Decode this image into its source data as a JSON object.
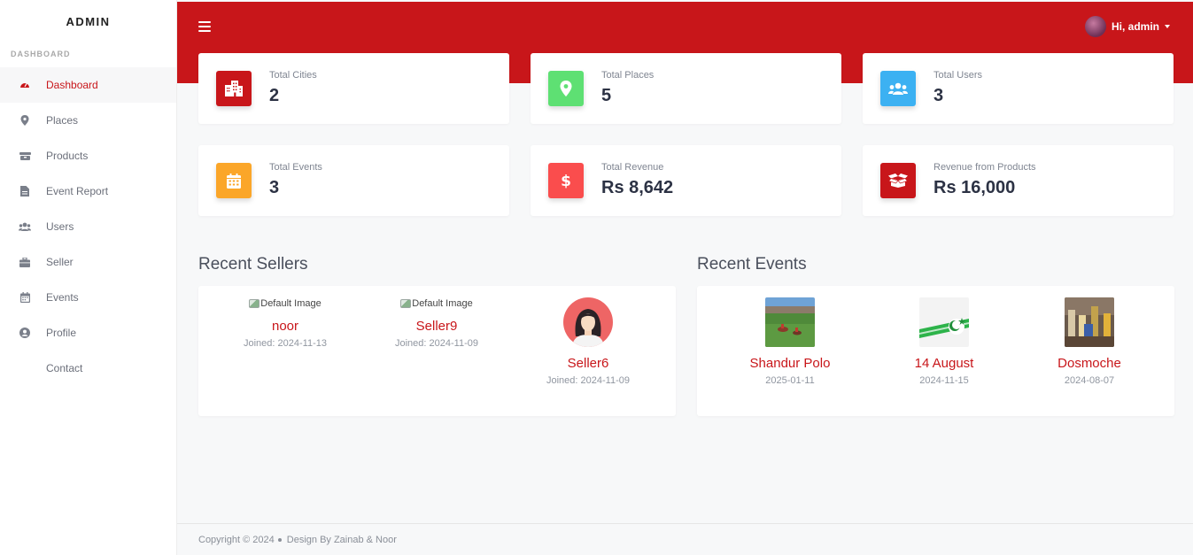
{
  "sidebar": {
    "brand": "ADMIN",
    "section_label": "DASHBOARD",
    "items": [
      {
        "label": "Dashboard",
        "icon": "gauge-icon",
        "active": true
      },
      {
        "label": "Places",
        "icon": "map-pin-icon"
      },
      {
        "label": "Products",
        "icon": "products-icon"
      },
      {
        "label": "Event Report",
        "icon": "file-icon"
      },
      {
        "label": "Users",
        "icon": "users-icon"
      },
      {
        "label": "Seller",
        "icon": "briefcase-icon"
      },
      {
        "label": "Events",
        "icon": "calendar-icon"
      },
      {
        "label": "Profile",
        "icon": "user-circle-icon"
      },
      {
        "label": "Contact",
        "icon": ""
      }
    ]
  },
  "header": {
    "greeting": "Hi, admin",
    "menu_icon": "hamburger-icon"
  },
  "stats": [
    {
      "label": "Total Cities",
      "value": "2",
      "icon": "city-icon",
      "color": "#c8161a"
    },
    {
      "label": "Total Places",
      "value": "5",
      "icon": "map-pin-icon",
      "color": "#5ee073"
    },
    {
      "label": "Total Users",
      "value": "3",
      "icon": "users-icon",
      "color": "#3cb1f2"
    },
    {
      "label": "Total Events",
      "value": "3",
      "icon": "calendar-icon",
      "color": "#fba629"
    },
    {
      "label": "Total Revenue",
      "value": "Rs 8,642",
      "icon": "dollar-icon",
      "color": "#fa4d4d"
    },
    {
      "label": "Revenue from Products",
      "value": "Rs 16,000",
      "icon": "box-icon",
      "color": "#c8161a"
    }
  ],
  "recent_sellers": {
    "title": "Recent Sellers",
    "items": [
      {
        "image_alt": "Default Image",
        "name": "noor",
        "joined": "Joined: 2024-11-13"
      },
      {
        "image_alt": "Default Image",
        "name": "Seller9",
        "joined": "Joined: 2024-11-09"
      },
      {
        "image_alt": "",
        "name": "Seller6",
        "joined": "Joined: 2024-11-09"
      }
    ]
  },
  "recent_events": {
    "title": "Recent Events",
    "items": [
      {
        "name": "Shandur Polo",
        "date": "2025-01-11"
      },
      {
        "name": "14 August",
        "date": "2024-11-15"
      },
      {
        "name": "Dosmoche",
        "date": "2024-08-07"
      }
    ]
  },
  "footer": {
    "copyright": "Copyright © 2024",
    "credit": "Design By Zainab & Noor"
  },
  "colors": {
    "accent": "#c8161a",
    "background": "#f7f8f9"
  }
}
